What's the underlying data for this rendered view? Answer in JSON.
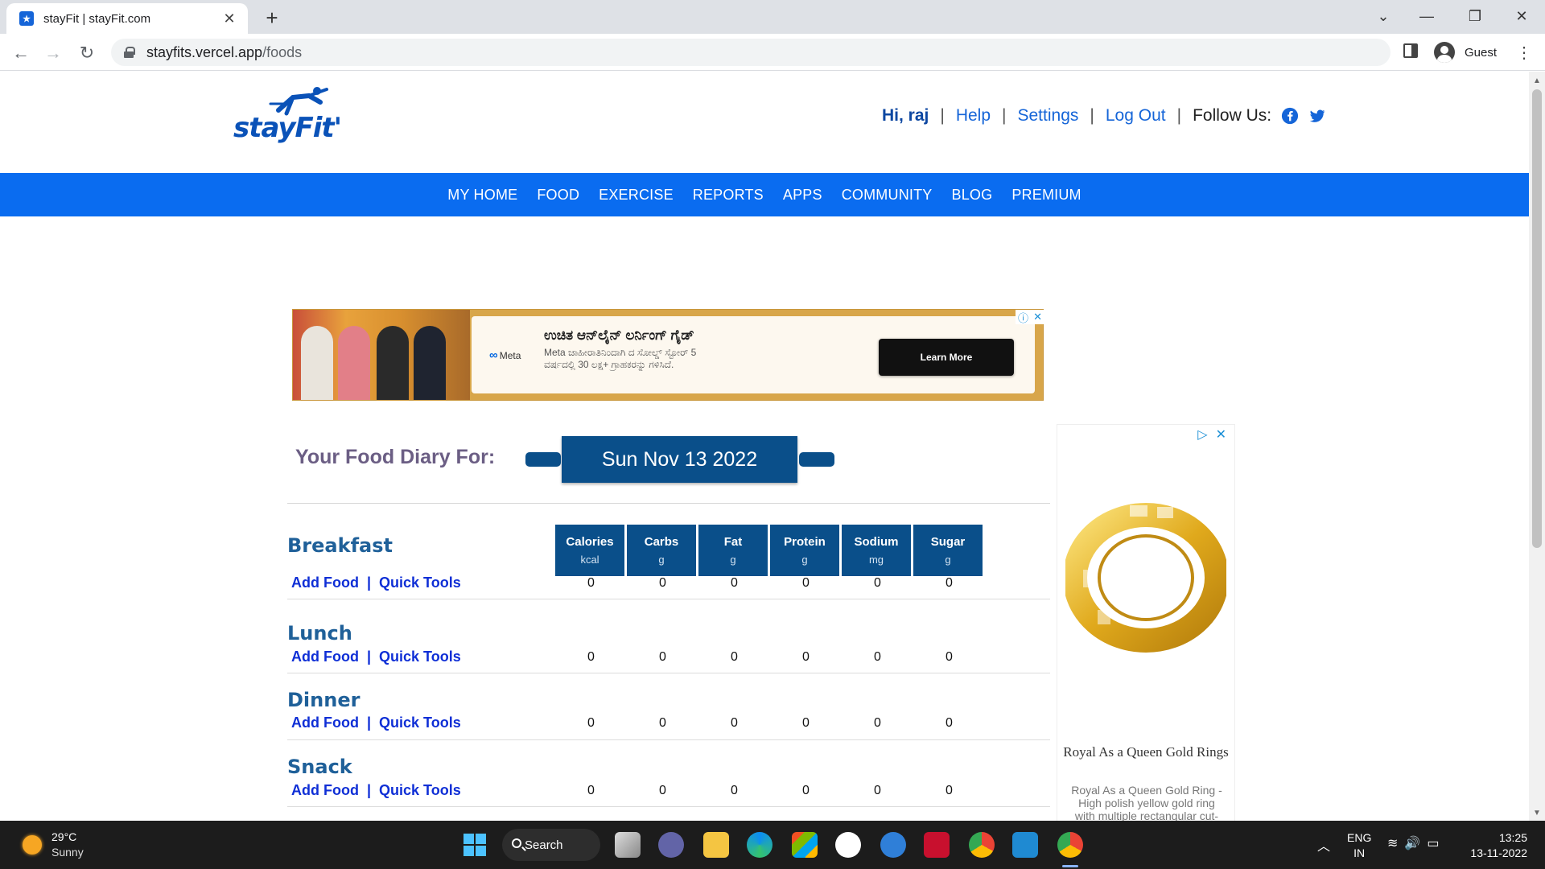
{
  "browser": {
    "tab_title": "stayFit | stayFit.com",
    "url_host": "stayfits.vercel.app",
    "url_path": "/foods",
    "profile_label": "Guest"
  },
  "header": {
    "logo_text": "stayFit'",
    "greeting": "Hi, raj",
    "help": "Help",
    "settings": "Settings",
    "logout": "Log Out",
    "follow": "Follow Us:"
  },
  "nav": [
    "MY HOME",
    "FOOD",
    "EXERCISE",
    "REPORTS",
    "APPS",
    "COMMUNITY",
    "BLOG",
    "PREMIUM"
  ],
  "ad_banner": {
    "brand": "Meta",
    "title": "ಉಚಿತ ಆನ್‌ಲೈನ್ ಲರ್ನಿಂಗ್ ಗೈಡ್",
    "desc": "Meta ಜಾಹೀರಾತಿನಿಂದಾಗಿ ದ ಸೋಲ್ಡ್ ಸ್ಟೋರ್ 5 ವರ್ಷದಲ್ಲಿ 30 ಲಕ್ಷ+ ಗ್ರಾಹಕರನ್ನು ಗಳಿಸಿದೆ.",
    "cta": "Learn More"
  },
  "diary": {
    "label": "Your Food Diary For:",
    "date": "Sun Nov 13 2022"
  },
  "nutrients": [
    {
      "name": "Calories",
      "unit": "kcal"
    },
    {
      "name": "Carbs",
      "unit": "g"
    },
    {
      "name": "Fat",
      "unit": "g"
    },
    {
      "name": "Protein",
      "unit": "g"
    },
    {
      "name": "Sodium",
      "unit": "mg"
    },
    {
      "name": "Sugar",
      "unit": "g"
    }
  ],
  "meal_links": {
    "add": "Add Food",
    "sep": "|",
    "quick": "Quick Tools"
  },
  "meals": [
    {
      "name": "Breakfast",
      "values": [
        "0",
        "0",
        "0",
        "0",
        "0",
        "0"
      ]
    },
    {
      "name": "Lunch",
      "values": [
        "0",
        "0",
        "0",
        "0",
        "0",
        "0"
      ]
    },
    {
      "name": "Dinner",
      "values": [
        "0",
        "0",
        "0",
        "0",
        "0",
        "0"
      ]
    },
    {
      "name": "Snack",
      "values": [
        "0",
        "0",
        "0",
        "0",
        "0",
        "0"
      ]
    }
  ],
  "side_ad": {
    "title": "Royal As a Queen Gold Rings",
    "desc": "Royal As a Queen Gold Ring - High polish yellow gold ring with multiple rectangular cut-work"
  },
  "taskbar": {
    "temp": "29°C",
    "weather": "Sunny",
    "search": "Search",
    "lang1": "ENG",
    "lang2": "IN",
    "time": "13:25",
    "date": "13-11-2022"
  },
  "colors": {
    "nav_blue": "#0a6cf0",
    "diary_blue": "#0a4f8a",
    "meal_name": "#1f6099",
    "link_blue": "#0f2fd6"
  }
}
